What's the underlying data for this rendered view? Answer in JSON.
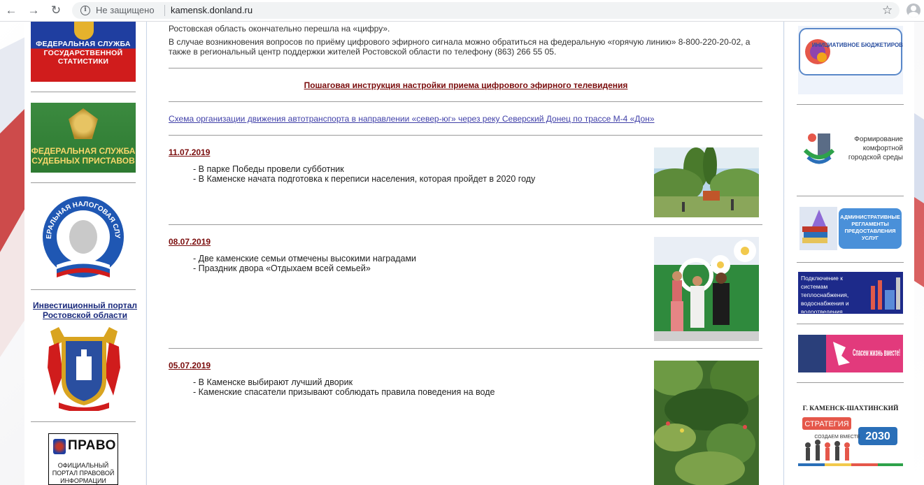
{
  "browser": {
    "security_text": "Не защищено",
    "url": "kamensk.donland.ru"
  },
  "left_banners": {
    "rosstat": "ФЕДЕРАЛЬНАЯ СЛУЖБА ГОСУДАРСТВЕННОЙ СТАТИСТИКИ",
    "fssp": "ФЕДЕРАЛЬНАЯ СЛУЖБА СУДЕБНЫХ ПРИСТАВОВ",
    "fns": "ФЕДЕРАЛЬНАЯ НАЛОГОВАЯ СЛУЖБА",
    "investment_portal": "Инвестиционный портал Ростовской области",
    "pravo_title": "ПРАВО",
    "pravo_subtitle": "ОФИЦИАЛЬНЫЙ ПОРТАЛ ПРАВОВОЙ ИНФОРМАЦИИ"
  },
  "content": {
    "para1": "Ростовская область окончательно перешла на «цифру».",
    "para2": "В случае возникновения вопросов по приёму цифрового эфирного сигнала можно обратиться на федеральную «горячую линию» 8-800-220-20-02, а также в региональный центр поддержки жителей Ростовской области по телефону (863) 266 55 05.",
    "instruction_link": "Пошаговая инструкция настройки приема цифрового эфирного телевидения",
    "scheme_link": "Схема организации движения автотранспорта в направлении «север-юг» через реку Северский Донец по трассе М-4 «Дон»"
  },
  "news": [
    {
      "date": "11.07.2019",
      "items": [
        "- В парке Победы провели субботник",
        "- В Каменске начата подготовка к переписи населения, которая пройдет в 2020 году"
      ]
    },
    {
      "date": "08.07.2019",
      "items": [
        "- Две каменские семьи отмечены высокими наградами",
        "- Праздник двора «Отдыхаем всей семьей»"
      ]
    },
    {
      "date": "05.07.2019",
      "items": [
        "- В Каменске выбирают лучший дворик",
        "- Каменские спасатели призывают соблюдать правила поведения на воде"
      ]
    }
  ],
  "right_banners": {
    "initiative_budgeting": "ИНИЦИАТИВНОЕ БЮДЖЕТИРОВАНИЕ",
    "comfort_env": "Формирование комфортной городской среды",
    "admin_regulations": "АДМИНИСТРАТИВНЫЕ РЕГЛАМЕНТЫ ПРЕДОСТАВЛЕНИЯ УСЛУГ",
    "utilities": "Подключение к системам теплоснабжения, водоснабжения и водоотведения",
    "save_life": "Спасем жизнь вместе!",
    "strategy_city": "Г. КАМЕНСК-ШАХТИНСКИЙ",
    "strategy_label": "СТРАТЕГИЯ",
    "strategy_year": "2030",
    "strategy_sub": "СОЗДАЕМ ВМЕСТЕ"
  }
}
